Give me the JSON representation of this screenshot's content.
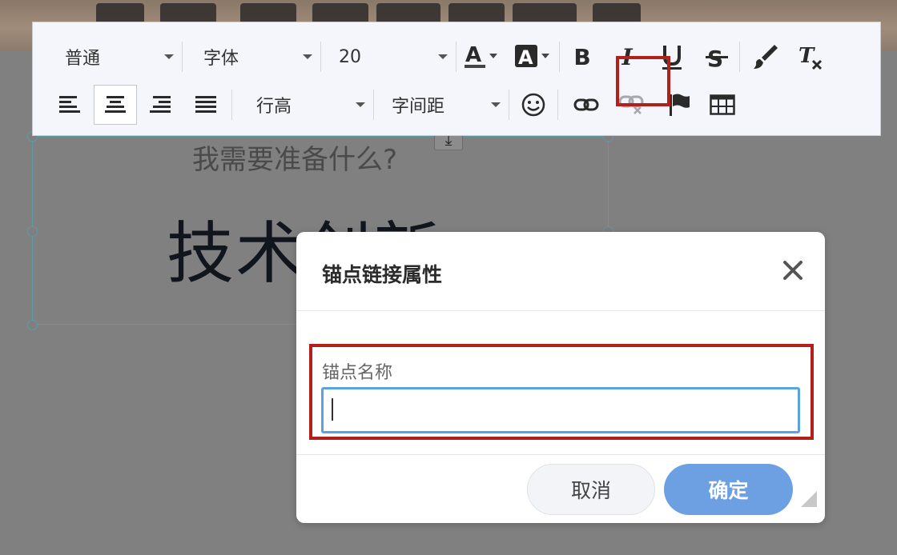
{
  "background": {
    "subtitle": "我需要准备什么?",
    "title": "技术创新"
  },
  "toolbar": {
    "paragraph_format": "普通",
    "font_family": "字体",
    "font_size": "20",
    "line_height": "行高",
    "letter_spacing": "字间距"
  },
  "dialog": {
    "title": "锚点链接属性",
    "field_label": "锚点名称",
    "field_value": "",
    "cancel_label": "取消",
    "ok_label": "确定"
  },
  "colors": {
    "highlight": "#b3201c",
    "primary_button": "#6d9fe3",
    "input_focus": "#5aa3de"
  }
}
